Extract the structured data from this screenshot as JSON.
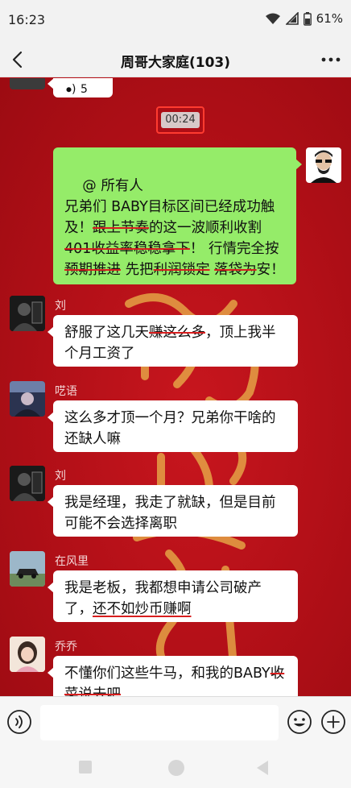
{
  "status_bar": {
    "time": "16:23",
    "battery": "61%"
  },
  "header": {
    "title": "周哥大家庭(103)",
    "back_icon": "chevron-left-icon",
    "more_icon": "more-dots-icon"
  },
  "chat": {
    "prev_snippet": "5",
    "timestamp": "00:24",
    "messages": [
      {
        "sender": "",
        "side": "right",
        "segments": [
          {
            "t": "@ 所有人\n兄弟们 BABY目标区间已经成功触及！"
          },
          {
            "t": "跟上节奏",
            "s": true
          },
          {
            "t": "的这一波顺利收割"
          },
          {
            "t": "401收益率",
            "s": true
          },
          {
            "t": "稳稳拿下",
            "s": true
          },
          {
            "t": "！ 行情完全按"
          },
          {
            "t": "预期推进",
            "s": true
          },
          {
            "t": " 先把"
          },
          {
            "t": "利润锁定",
            "s": true
          },
          {
            "t": " "
          },
          {
            "t": "落袋为",
            "s": true
          },
          {
            "t": "安！"
          }
        ]
      },
      {
        "sender": "刘",
        "side": "left",
        "segments": [
          {
            "t": "舒服了这几天"
          },
          {
            "t": "赚这么多",
            "s": true
          },
          {
            "t": "，顶上我半个月工资了"
          }
        ]
      },
      {
        "sender": "呓语",
        "side": "left",
        "segments": [
          {
            "t": "这么多才顶一个月？兄弟你干啥的还缺人嘛"
          }
        ]
      },
      {
        "sender": "刘",
        "side": "left",
        "segments": [
          {
            "t": "我是经理，我走了就缺，但是目前可能不会选择离职"
          }
        ]
      },
      {
        "sender": "在风里",
        "side": "left",
        "segments": [
          {
            "t": "我是老板，我都想申请公司破产了，"
          },
          {
            "t": "还不如炒币赚啊",
            "u": true
          }
        ]
      },
      {
        "sender": "乔乔",
        "side": "left",
        "segments": [
          {
            "t": "不懂你们这些牛马，和我的BABY"
          },
          {
            "t": "收菜说去吧",
            "s": true
          }
        ]
      }
    ]
  },
  "input_bar": {
    "voice_icon": "voice-icon",
    "emoji_icon": "emoji-icon",
    "plus_icon": "plus-circle-icon",
    "value": ""
  },
  "colors": {
    "accent_red": "#d81e1e",
    "bubble_green": "#95ec69",
    "background_red": "#b8121a"
  }
}
